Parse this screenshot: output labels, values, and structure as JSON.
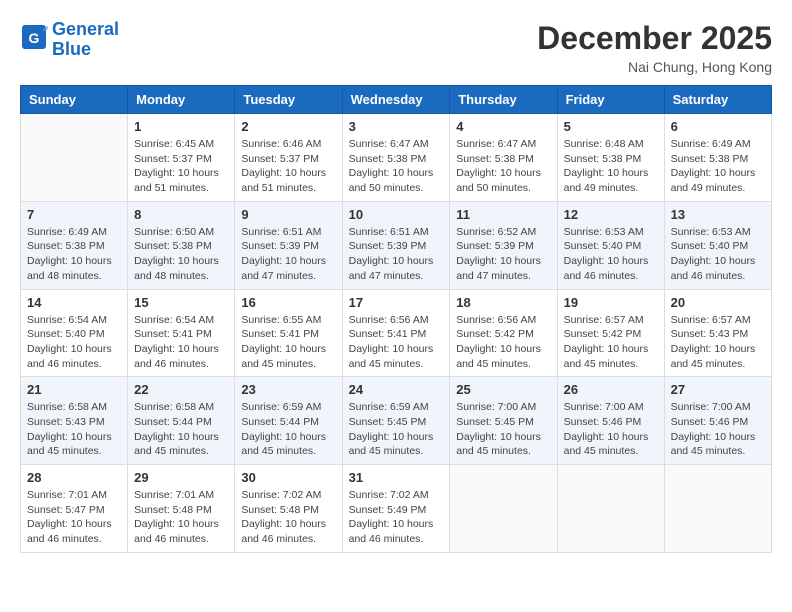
{
  "header": {
    "logo": {
      "line1": "General",
      "line2": "Blue"
    },
    "title": "December 2025",
    "location": "Nai Chung, Hong Kong"
  },
  "days_of_week": [
    "Sunday",
    "Monday",
    "Tuesday",
    "Wednesday",
    "Thursday",
    "Friday",
    "Saturday"
  ],
  "weeks": [
    [
      {
        "day": "",
        "info": ""
      },
      {
        "day": "1",
        "info": "Sunrise: 6:45 AM\nSunset: 5:37 PM\nDaylight: 10 hours\nand 51 minutes."
      },
      {
        "day": "2",
        "info": "Sunrise: 6:46 AM\nSunset: 5:37 PM\nDaylight: 10 hours\nand 51 minutes."
      },
      {
        "day": "3",
        "info": "Sunrise: 6:47 AM\nSunset: 5:38 PM\nDaylight: 10 hours\nand 50 minutes."
      },
      {
        "day": "4",
        "info": "Sunrise: 6:47 AM\nSunset: 5:38 PM\nDaylight: 10 hours\nand 50 minutes."
      },
      {
        "day": "5",
        "info": "Sunrise: 6:48 AM\nSunset: 5:38 PM\nDaylight: 10 hours\nand 49 minutes."
      },
      {
        "day": "6",
        "info": "Sunrise: 6:49 AM\nSunset: 5:38 PM\nDaylight: 10 hours\nand 49 minutes."
      }
    ],
    [
      {
        "day": "7",
        "info": "Sunrise: 6:49 AM\nSunset: 5:38 PM\nDaylight: 10 hours\nand 48 minutes."
      },
      {
        "day": "8",
        "info": "Sunrise: 6:50 AM\nSunset: 5:38 PM\nDaylight: 10 hours\nand 48 minutes."
      },
      {
        "day": "9",
        "info": "Sunrise: 6:51 AM\nSunset: 5:39 PM\nDaylight: 10 hours\nand 47 minutes."
      },
      {
        "day": "10",
        "info": "Sunrise: 6:51 AM\nSunset: 5:39 PM\nDaylight: 10 hours\nand 47 minutes."
      },
      {
        "day": "11",
        "info": "Sunrise: 6:52 AM\nSunset: 5:39 PM\nDaylight: 10 hours\nand 47 minutes."
      },
      {
        "day": "12",
        "info": "Sunrise: 6:53 AM\nSunset: 5:40 PM\nDaylight: 10 hours\nand 46 minutes."
      },
      {
        "day": "13",
        "info": "Sunrise: 6:53 AM\nSunset: 5:40 PM\nDaylight: 10 hours\nand 46 minutes."
      }
    ],
    [
      {
        "day": "14",
        "info": "Sunrise: 6:54 AM\nSunset: 5:40 PM\nDaylight: 10 hours\nand 46 minutes."
      },
      {
        "day": "15",
        "info": "Sunrise: 6:54 AM\nSunset: 5:41 PM\nDaylight: 10 hours\nand 46 minutes."
      },
      {
        "day": "16",
        "info": "Sunrise: 6:55 AM\nSunset: 5:41 PM\nDaylight: 10 hours\nand 45 minutes."
      },
      {
        "day": "17",
        "info": "Sunrise: 6:56 AM\nSunset: 5:41 PM\nDaylight: 10 hours\nand 45 minutes."
      },
      {
        "day": "18",
        "info": "Sunrise: 6:56 AM\nSunset: 5:42 PM\nDaylight: 10 hours\nand 45 minutes."
      },
      {
        "day": "19",
        "info": "Sunrise: 6:57 AM\nSunset: 5:42 PM\nDaylight: 10 hours\nand 45 minutes."
      },
      {
        "day": "20",
        "info": "Sunrise: 6:57 AM\nSunset: 5:43 PM\nDaylight: 10 hours\nand 45 minutes."
      }
    ],
    [
      {
        "day": "21",
        "info": "Sunrise: 6:58 AM\nSunset: 5:43 PM\nDaylight: 10 hours\nand 45 minutes."
      },
      {
        "day": "22",
        "info": "Sunrise: 6:58 AM\nSunset: 5:44 PM\nDaylight: 10 hours\nand 45 minutes."
      },
      {
        "day": "23",
        "info": "Sunrise: 6:59 AM\nSunset: 5:44 PM\nDaylight: 10 hours\nand 45 minutes."
      },
      {
        "day": "24",
        "info": "Sunrise: 6:59 AM\nSunset: 5:45 PM\nDaylight: 10 hours\nand 45 minutes."
      },
      {
        "day": "25",
        "info": "Sunrise: 7:00 AM\nSunset: 5:45 PM\nDaylight: 10 hours\nand 45 minutes."
      },
      {
        "day": "26",
        "info": "Sunrise: 7:00 AM\nSunset: 5:46 PM\nDaylight: 10 hours\nand 45 minutes."
      },
      {
        "day": "27",
        "info": "Sunrise: 7:00 AM\nSunset: 5:46 PM\nDaylight: 10 hours\nand 45 minutes."
      }
    ],
    [
      {
        "day": "28",
        "info": "Sunrise: 7:01 AM\nSunset: 5:47 PM\nDaylight: 10 hours\nand 46 minutes."
      },
      {
        "day": "29",
        "info": "Sunrise: 7:01 AM\nSunset: 5:48 PM\nDaylight: 10 hours\nand 46 minutes."
      },
      {
        "day": "30",
        "info": "Sunrise: 7:02 AM\nSunset: 5:48 PM\nDaylight: 10 hours\nand 46 minutes."
      },
      {
        "day": "31",
        "info": "Sunrise: 7:02 AM\nSunset: 5:49 PM\nDaylight: 10 hours\nand 46 minutes."
      },
      {
        "day": "",
        "info": ""
      },
      {
        "day": "",
        "info": ""
      },
      {
        "day": "",
        "info": ""
      }
    ]
  ]
}
